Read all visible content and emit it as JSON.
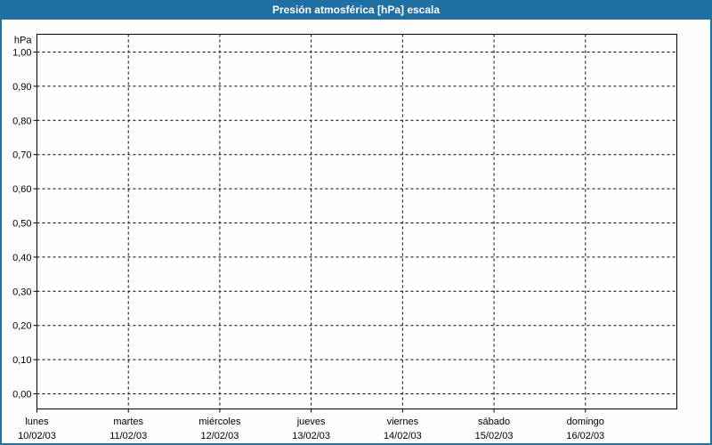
{
  "window": {
    "title": "Presión atmosférica [hPa] escala"
  },
  "colors": {
    "titlebar_bg": "#2170a3",
    "window_border": "#2170a3",
    "window_bg": "#fcfdfc",
    "plot_bg": "#fefefe",
    "grid_color": "#000000",
    "text_color": "#000000",
    "title_text": "#ffffff"
  },
  "chart_data": {
    "type": "line",
    "title": "Presión atmosférica [hPa] escala",
    "grid": "dashed",
    "legend": "none",
    "y_axis": {
      "unit_label": "hPa",
      "min": 0.0,
      "max": 1.0,
      "step": 0.1,
      "tick_labels_top_to_bottom": [
        "1,00",
        "0,90",
        "0,80",
        "0,70",
        "0,60",
        "0,50",
        "0,40",
        "0,30",
        "0,20",
        "0,10",
        "0,00"
      ]
    },
    "x_axis": {
      "categories": [
        {
          "day": "lunes",
          "date": "10/02/03"
        },
        {
          "day": "martes",
          "date": "11/02/03"
        },
        {
          "day": "miércoles",
          "date": "12/02/03"
        },
        {
          "day": "jueves",
          "date": "13/02/03"
        },
        {
          "day": "viernes",
          "date": "14/02/03"
        },
        {
          "day": "sábado",
          "date": "15/02/03"
        },
        {
          "day": "domingo",
          "date": "16/02/03"
        }
      ]
    },
    "series": []
  }
}
